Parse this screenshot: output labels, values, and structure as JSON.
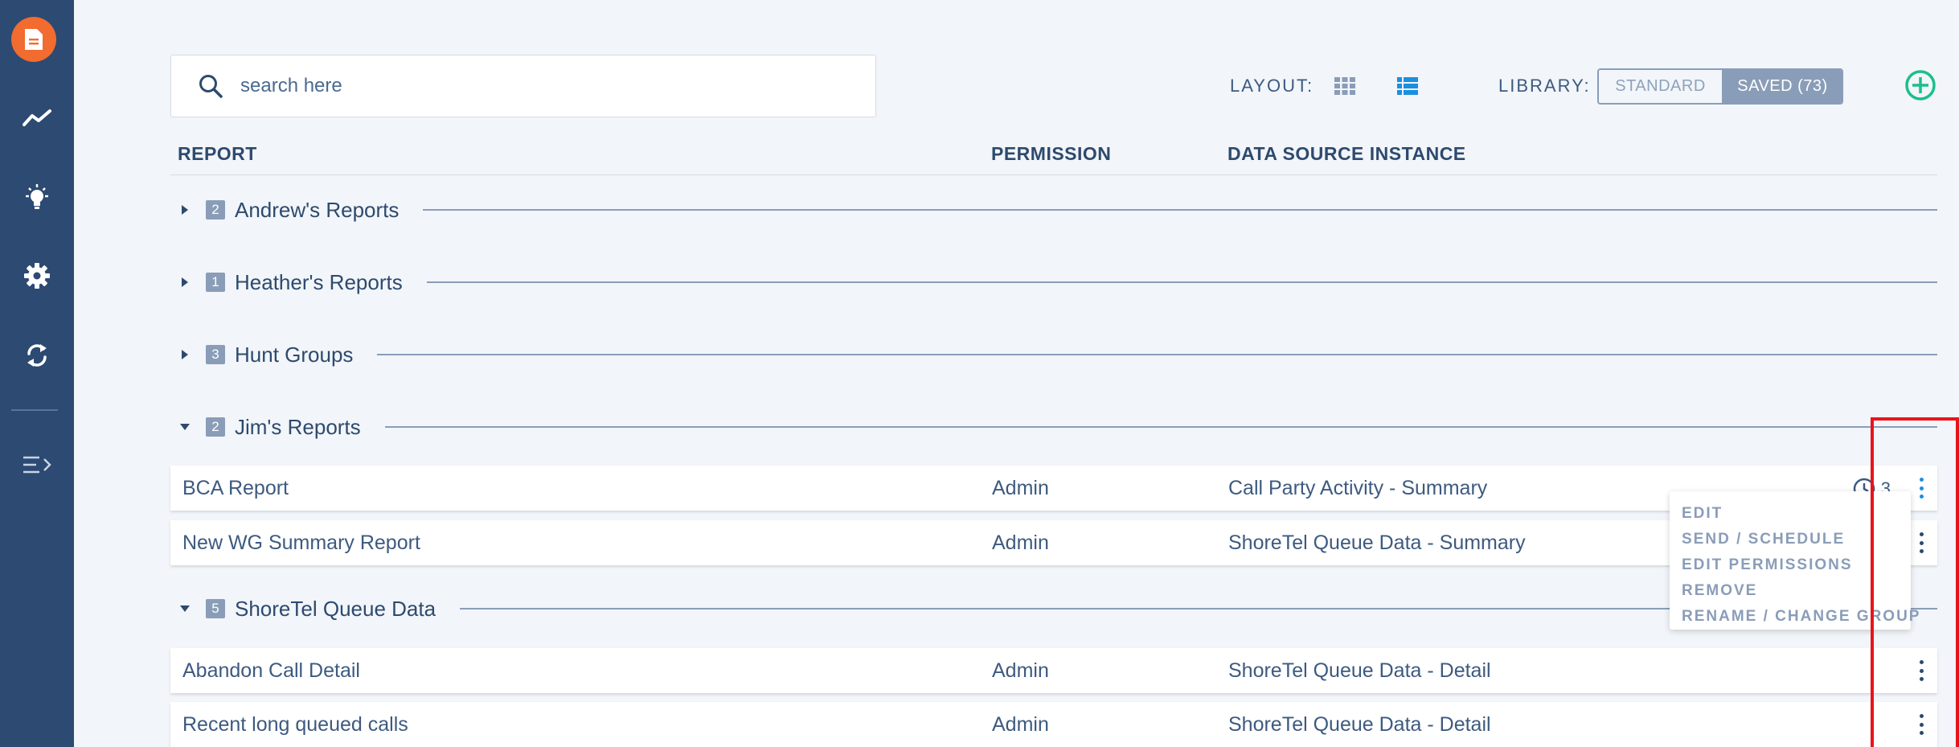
{
  "sidebar": {
    "icons": [
      "report-icon",
      "trend-icon",
      "lightbulb-icon",
      "gear-icon",
      "sync-icon",
      "expand-menu-icon"
    ]
  },
  "search": {
    "placeholder": "search here"
  },
  "toolbar": {
    "layout_label": "LAYOUT:",
    "library_label": "LIBRARY:",
    "standard_label": "STANDARD",
    "saved_label": "SAVED (73)"
  },
  "columns": {
    "report": "REPORT",
    "permission": "PERMISSION",
    "source": "DATA SOURCE INSTANCE"
  },
  "groups": [
    {
      "count": "2",
      "title": "Andrew's Reports",
      "expanded": false
    },
    {
      "count": "1",
      "title": "Heather's Reports",
      "expanded": false
    },
    {
      "count": "3",
      "title": "Hunt Groups",
      "expanded": false
    },
    {
      "count": "2",
      "title": "Jim's Reports",
      "expanded": true
    },
    {
      "count": "5",
      "title": "ShoreTel Queue Data",
      "expanded": true
    }
  ],
  "rows": [
    {
      "name": "BCA Report",
      "permission": "Admin",
      "source": "Call Party Activity - Summary",
      "schedule": "3"
    },
    {
      "name": "New WG Summary Report",
      "permission": "Admin",
      "source": "ShoreTel Queue Data - Summary"
    },
    {
      "name": "Abandon Call Detail",
      "permission": "Admin",
      "source": "ShoreTel Queue Data - Detail"
    },
    {
      "name": "Recent long queued calls",
      "permission": "Admin",
      "source": "ShoreTel Queue Data - Detail"
    }
  ],
  "menu": {
    "items": [
      "EDIT",
      "SEND / SCHEDULE",
      "EDIT PERMISSIONS",
      "REMOVE",
      "RENAME / CHANGE GROUP"
    ]
  },
  "colors": {
    "sidebar": "#2c4a72",
    "logo": "#f26b2f",
    "accent": "#1b8fe0",
    "add": "#1bbf8a",
    "highlight": "#e8141c"
  }
}
